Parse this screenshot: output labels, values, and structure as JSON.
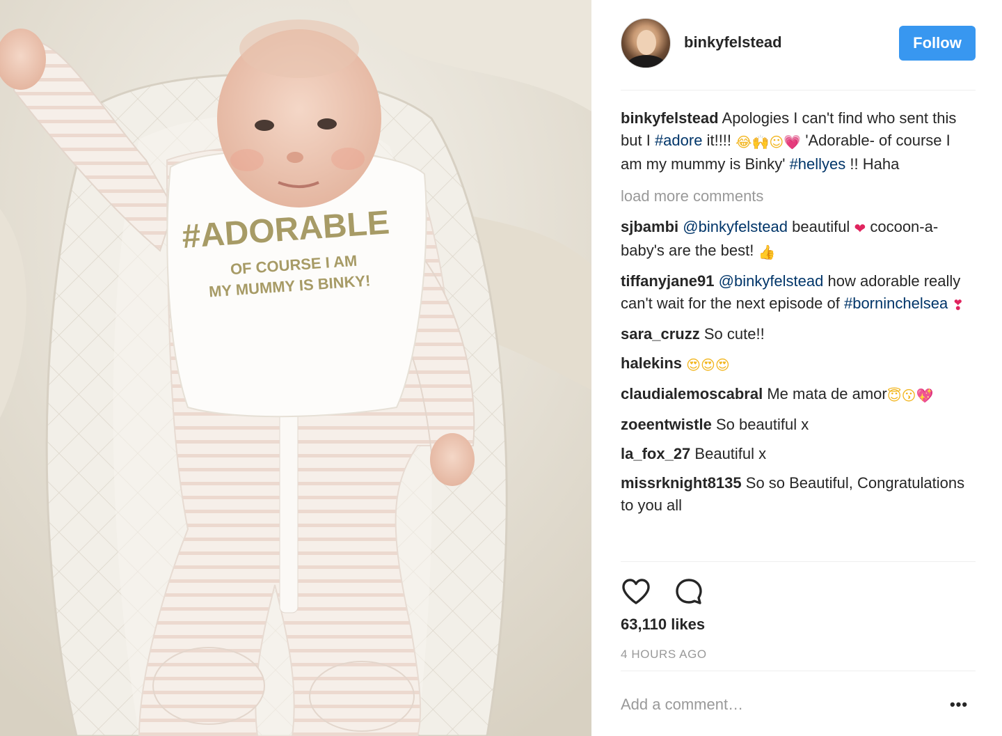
{
  "post": {
    "username": "binkyfelstead",
    "follow_label": "Follow",
    "photo": {
      "bib_line1": "#ADORABLE",
      "bib_line2": "OF COURSE I AM",
      "bib_line3": "MY MUMMY IS BINKY!"
    },
    "caption": {
      "user": "binkyfelstead",
      "text_a": "Apologies I can't find who sent this but I",
      "tag_a": "#adore",
      "text_b": "it!!!!",
      "emoji": "😂🙌☺💗",
      "text_c": "'Adorable- of course I am my mummy is Binky'",
      "tag_b": "#hellyes",
      "text_d": "!! Haha"
    },
    "load_more": "load more comments",
    "comments": [
      {
        "user": "sjbambi",
        "mention": "@binkyfelstead",
        "text": "beautiful",
        "emoji_a": "❤",
        "text2": "cocoon-a-baby's are the best!",
        "emoji_b": "👍"
      },
      {
        "user": "tiffanyjane91",
        "mention": "@binkyfelstead",
        "text": "how adorable really can't wait for the next episode of",
        "tag": "#borninchelsea",
        "emoji": "❣"
      },
      {
        "user": "sara_cruzz",
        "text": "So cute!!"
      },
      {
        "user": "halekins",
        "emoji": "😍😍😍"
      },
      {
        "user": "claudialemoscabral",
        "text": "Me mata de amor",
        "emoji": "😇😗💖"
      },
      {
        "user": "zoeentwistle",
        "text": "So beautiful x"
      },
      {
        "user": "la_fox_27",
        "text": "Beautiful x"
      },
      {
        "user": "missrknight8135",
        "text": "So so Beautiful,",
        "text2": "Congratulations to you all"
      }
    ],
    "likes_count": "63,110 likes",
    "timestamp": "4 HOURS AGO",
    "add_comment_placeholder": "Add a comment…",
    "more_options": "•••",
    "icons": {
      "like": "heart-icon",
      "comment": "comment-bubble-icon",
      "more": "more-options-icon"
    },
    "colors": {
      "follow": "#3897f0",
      "hashtag": "#003569",
      "muted": "#999999"
    }
  }
}
